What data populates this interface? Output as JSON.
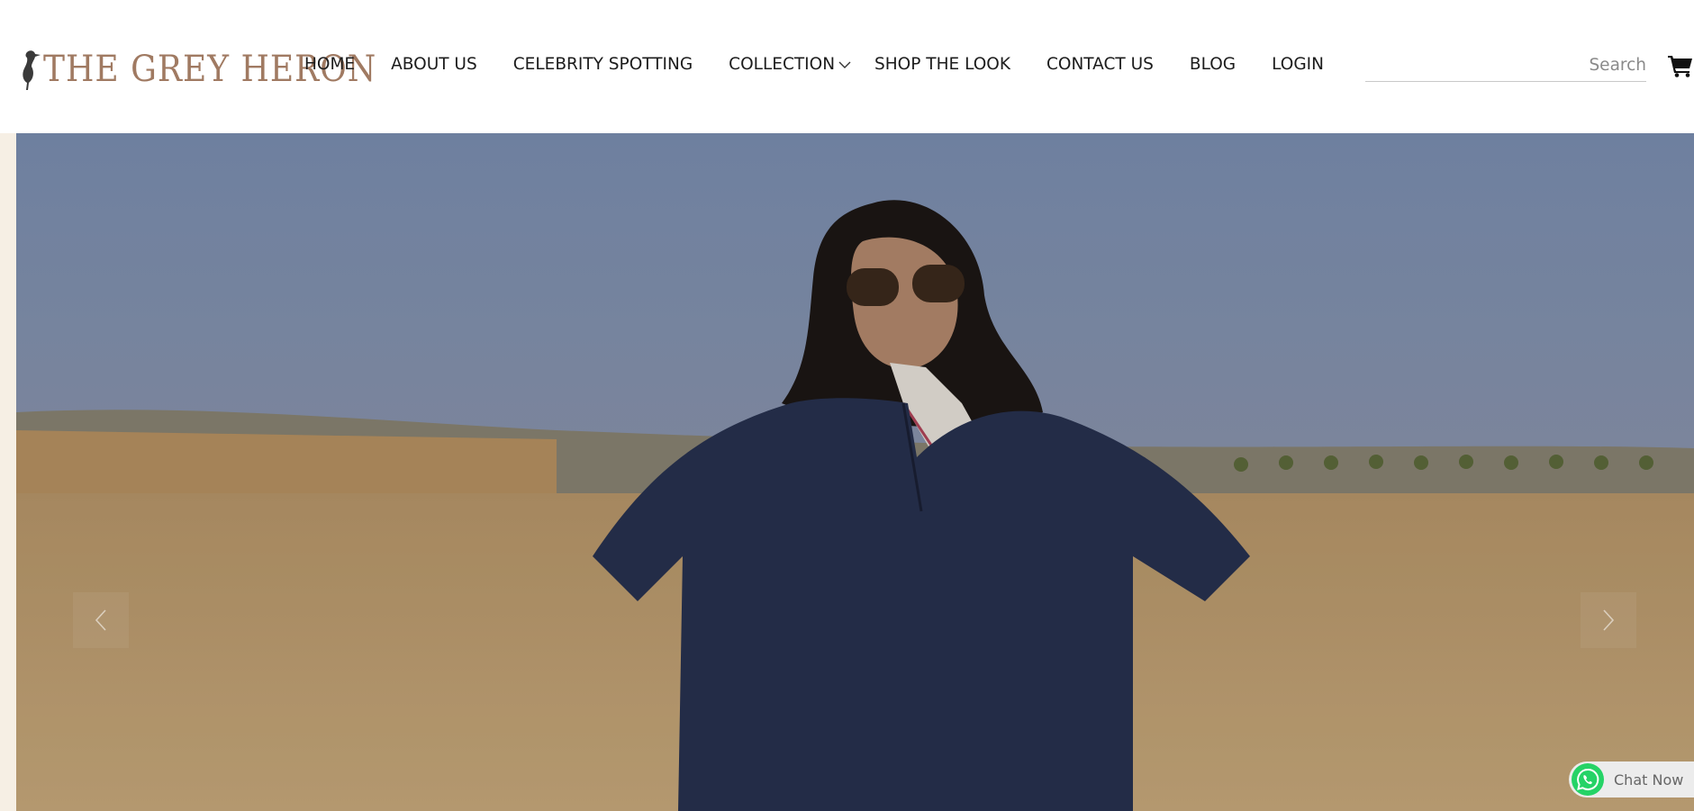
{
  "brand": {
    "logo_text": "THE GREY HERON"
  },
  "nav": {
    "items": [
      {
        "label": "HOME"
      },
      {
        "label": "ABOUT US"
      },
      {
        "label": "CELEBRITY SPOTTING"
      },
      {
        "label": "COLLECTION"
      },
      {
        "label": "SHOP THE LOOK"
      },
      {
        "label": "CONTACT US"
      },
      {
        "label": "BLOG"
      },
      {
        "label": "LOGIN"
      }
    ]
  },
  "search": {
    "placeholder": "Search",
    "value": ""
  },
  "icons": {
    "cart": "cart-icon",
    "collection_dropdown": "chevron-down-icon",
    "slider_prev": "chevron-left-icon",
    "slider_next": "chevron-right-icon",
    "chat": "whatsapp-icon"
  },
  "hero": {
    "image": "model-in-wheat-field"
  },
  "chat_widget": {
    "label": "Chat Now",
    "color": "#25D366"
  },
  "colors": {
    "brand": "#a07a62",
    "strip": "#f6efe4",
    "nav_text": "#1c1c1c"
  }
}
